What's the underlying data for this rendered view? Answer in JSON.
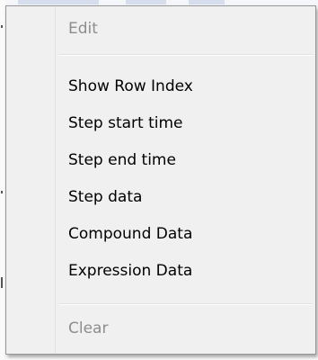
{
  "context_menu": {
    "items": [
      {
        "label": "Edit",
        "enabled": false
      },
      {
        "label": "Show Row Index",
        "enabled": true
      },
      {
        "label": "Step start time",
        "enabled": true
      },
      {
        "label": "Step end time",
        "enabled": true
      },
      {
        "label": "Step data",
        "enabled": true
      },
      {
        "label": "Compound Data",
        "enabled": true
      },
      {
        "label": "Expression Data",
        "enabled": true
      },
      {
        "label": "Clear",
        "enabled": false
      }
    ]
  },
  "colors": {
    "menu_background": "#f0f0f0",
    "menu_border": "#979797",
    "enabled_text": "#000000",
    "disabled_text": "#8d8d8d"
  }
}
